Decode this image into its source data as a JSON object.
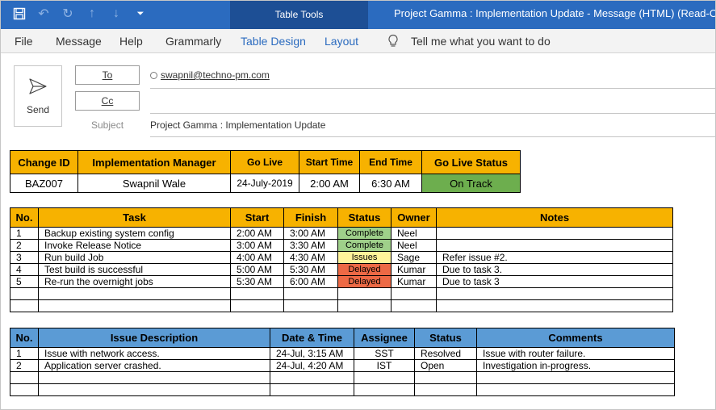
{
  "titlebar": {
    "context_tab": "Table Tools",
    "window_title": "Project Gamma : Implementation Update  -  Message (HTML) (Read-Only)"
  },
  "menu": {
    "items": [
      "File",
      "Message",
      "Help",
      "Grammarly",
      "Table Design",
      "Layout"
    ],
    "tell_me": "Tell me what you want to do"
  },
  "compose": {
    "send_label": "Send",
    "to_label": "To",
    "cc_label": "Cc",
    "subject_label": "Subject",
    "to_value": "swapnil@techno-pm.com",
    "subject_value": "Project Gamma : Implementation Update"
  },
  "summary": {
    "headers": [
      "Change ID",
      "Implementation Manager",
      "Go Live",
      "Start Time",
      "End Time",
      "Go Live Status"
    ],
    "row": [
      "BAZ007",
      "Swapnil Wale",
      "24-July-2019",
      "2:00 AM",
      "6:30 AM",
      "On Track"
    ]
  },
  "tasks": {
    "headers": [
      "No.",
      "Task",
      "Start",
      "Finish",
      "Status",
      "Owner",
      "Notes"
    ],
    "rows": [
      [
        "1",
        "Backup existing system config",
        "2:00 AM",
        "3:00 AM",
        "Complete",
        "Neel",
        ""
      ],
      [
        "2",
        "Invoke Release Notice",
        "3:00 AM",
        "3:30 AM",
        "Complete",
        "Neel",
        ""
      ],
      [
        "3",
        "Run build Job",
        "4:00 AM",
        "4:30 AM",
        "Issues",
        "Sage",
        "Refer issue #2."
      ],
      [
        "4",
        "Test build is successful",
        "5:00 AM",
        "5:30 AM",
        "Delayed",
        "Kumar",
        "Due to task 3."
      ],
      [
        "5",
        "Re-run the overnight jobs",
        "5:30 AM",
        "6:00 AM",
        "Delayed",
        "Kumar",
        "Due to task 3"
      ]
    ]
  },
  "issues": {
    "headers": [
      "No.",
      "Issue Description",
      "Date & Time",
      "Assignee",
      "Status",
      "Comments"
    ],
    "rows": [
      [
        "1",
        "Issue with network access.",
        "24-Jul, 3:15 AM",
        "SST",
        "Resolved",
        "Issue with router failure."
      ],
      [
        "2",
        "Application server crashed.",
        "24-Jul, 4:20 AM",
        "IST",
        "Open",
        "Investigation in-progress."
      ]
    ]
  },
  "colors": {
    "title_blue": "#2b6bbf",
    "header_orange": "#f7b200",
    "header_blue": "#5b9bd5",
    "complete": "#9fd08a",
    "issues": "#fff49a",
    "delayed": "#ed6945",
    "on_track": "#6dae4e"
  }
}
